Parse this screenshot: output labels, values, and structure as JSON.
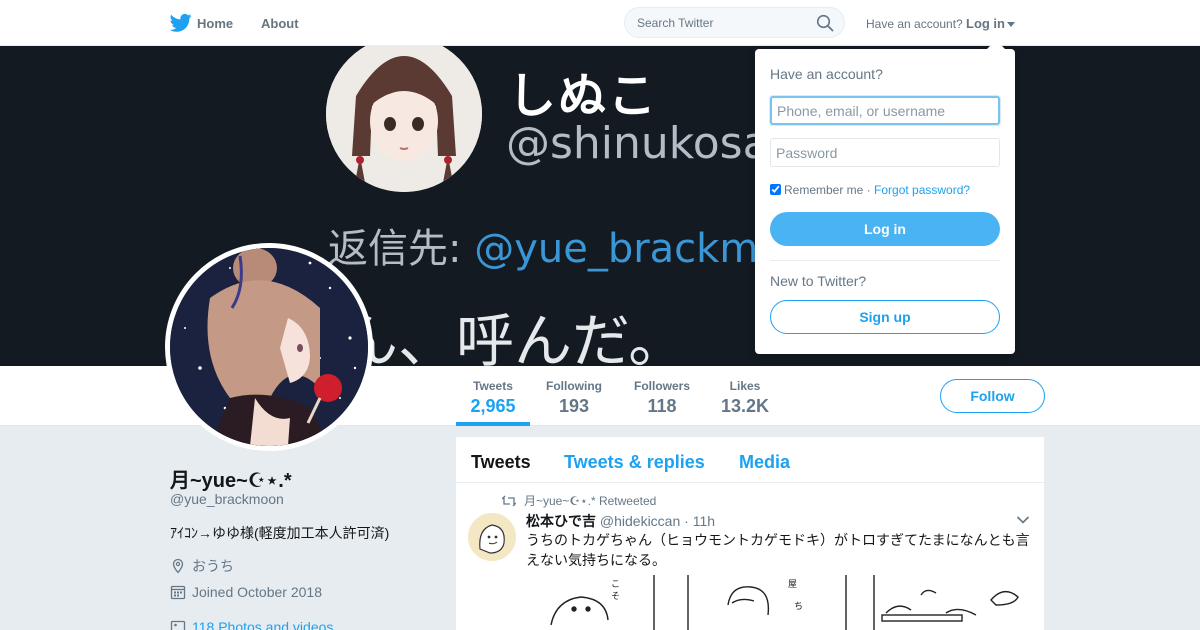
{
  "nav": {
    "home": "Home",
    "about": "About",
    "search_placeholder": "Search Twitter",
    "have_account": "Have an account?",
    "login": "Log in"
  },
  "banner": {
    "name": "しぬこ",
    "handle": "@shinukosa",
    "reply_prefix": "返信先: ",
    "reply_mention": "@yue_brackm",
    "bottom_text": "ん、呼んだ。"
  },
  "stats": [
    {
      "label": "Tweets",
      "value": "2,965"
    },
    {
      "label": "Following",
      "value": "193"
    },
    {
      "label": "Followers",
      "value": "118"
    },
    {
      "label": "Likes",
      "value": "13.2K"
    }
  ],
  "follow_label": "Follow",
  "profile": {
    "name": "月~yue~☪︎⋆.*",
    "handle": "@yue_brackmoon",
    "bio": "ｱｲｺﾝ→ゆゆ様(軽度加工本人許可済)",
    "location": "おうち",
    "joined": "Joined October 2018",
    "photos": "118 Photos and videos"
  },
  "timeline": {
    "tabs": [
      "Tweets",
      "Tweets & replies",
      "Media"
    ],
    "retweet_line": "月~yue~☪︎⋆.* Retweeted",
    "tweet": {
      "name": "松本ひで吉",
      "handle": "@hidekiccan",
      "time": "· 11h",
      "text": "うちのトカゲちゃん（ヒョウモントカゲモドキ）がトロすぎてたまになんとも言えない気持ちになる。"
    }
  },
  "login_dropdown": {
    "title": "Have an account?",
    "username_placeholder": "Phone, email, or username",
    "password_placeholder": "Password",
    "remember": "Remember me",
    "separator": " · ",
    "forgot": "Forgot password?",
    "login_button": "Log in",
    "new_to_twitter": "New to Twitter?",
    "signup_button": "Sign up"
  },
  "colors": {
    "accent": "#1da1f2",
    "login_button": "#4ab3f4",
    "banner_bg": "#141a22",
    "page_bg": "#e6ecf0"
  }
}
